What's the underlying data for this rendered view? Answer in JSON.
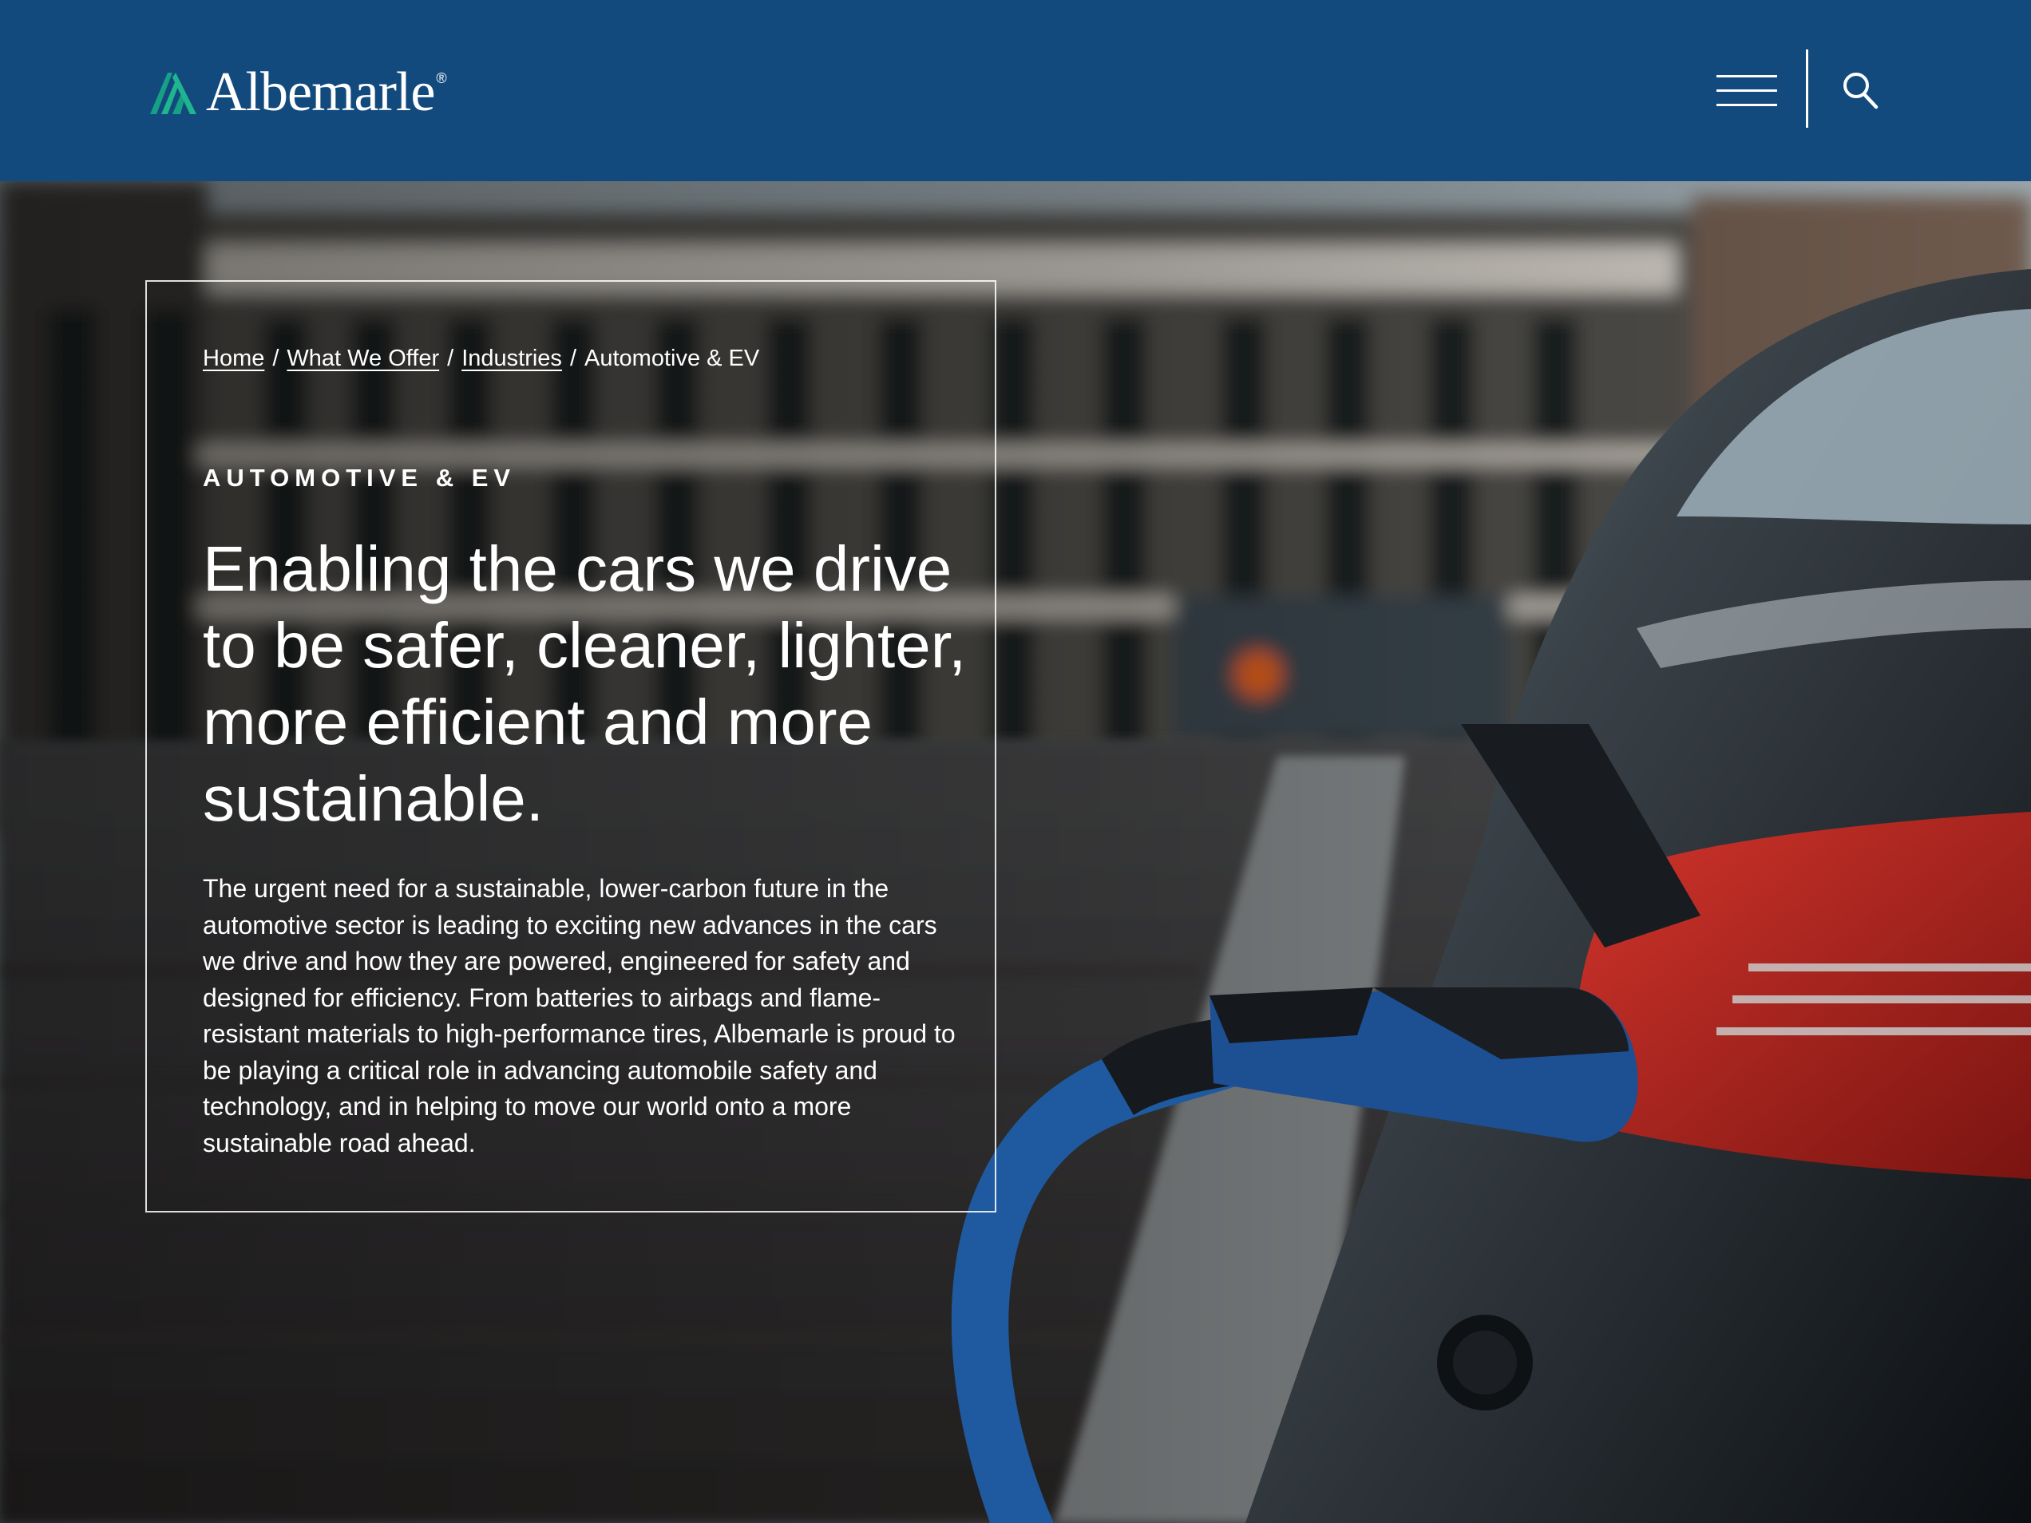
{
  "header": {
    "logo_text": "Albemarle",
    "logo_reg": "®",
    "menu_icon": "hamburger-menu-icon",
    "search_icon": "search-icon",
    "background_color": "#134a7e",
    "logo_accent_color": "#16a085"
  },
  "breadcrumb": {
    "items": [
      "Home",
      "What We Offer",
      "Industries"
    ],
    "separator": "/",
    "current": "Automotive & EV"
  },
  "hero": {
    "eyebrow": "AUTOMOTIVE & EV",
    "headline": "Enabling the cars we drive to be safer, cleaner, lighter, more efficient and more sustainable.",
    "body": "The urgent need for a sustainable, lower-carbon future in the automotive sector is leading to exciting new advances in the cars we drive and how they are powered, engineered for safety and designed for efficiency. From batteries to airbags and flame-resistant materials to high-performance tires, Albemarle is proud to be playing a critical role in advancing automobile safety and technology, and in helping to move our world onto a more sustainable road ahead.",
    "image_subject": "electric car charging on city street",
    "charger_color": "#1f5aa0",
    "taillight_color": "#b3201c"
  }
}
